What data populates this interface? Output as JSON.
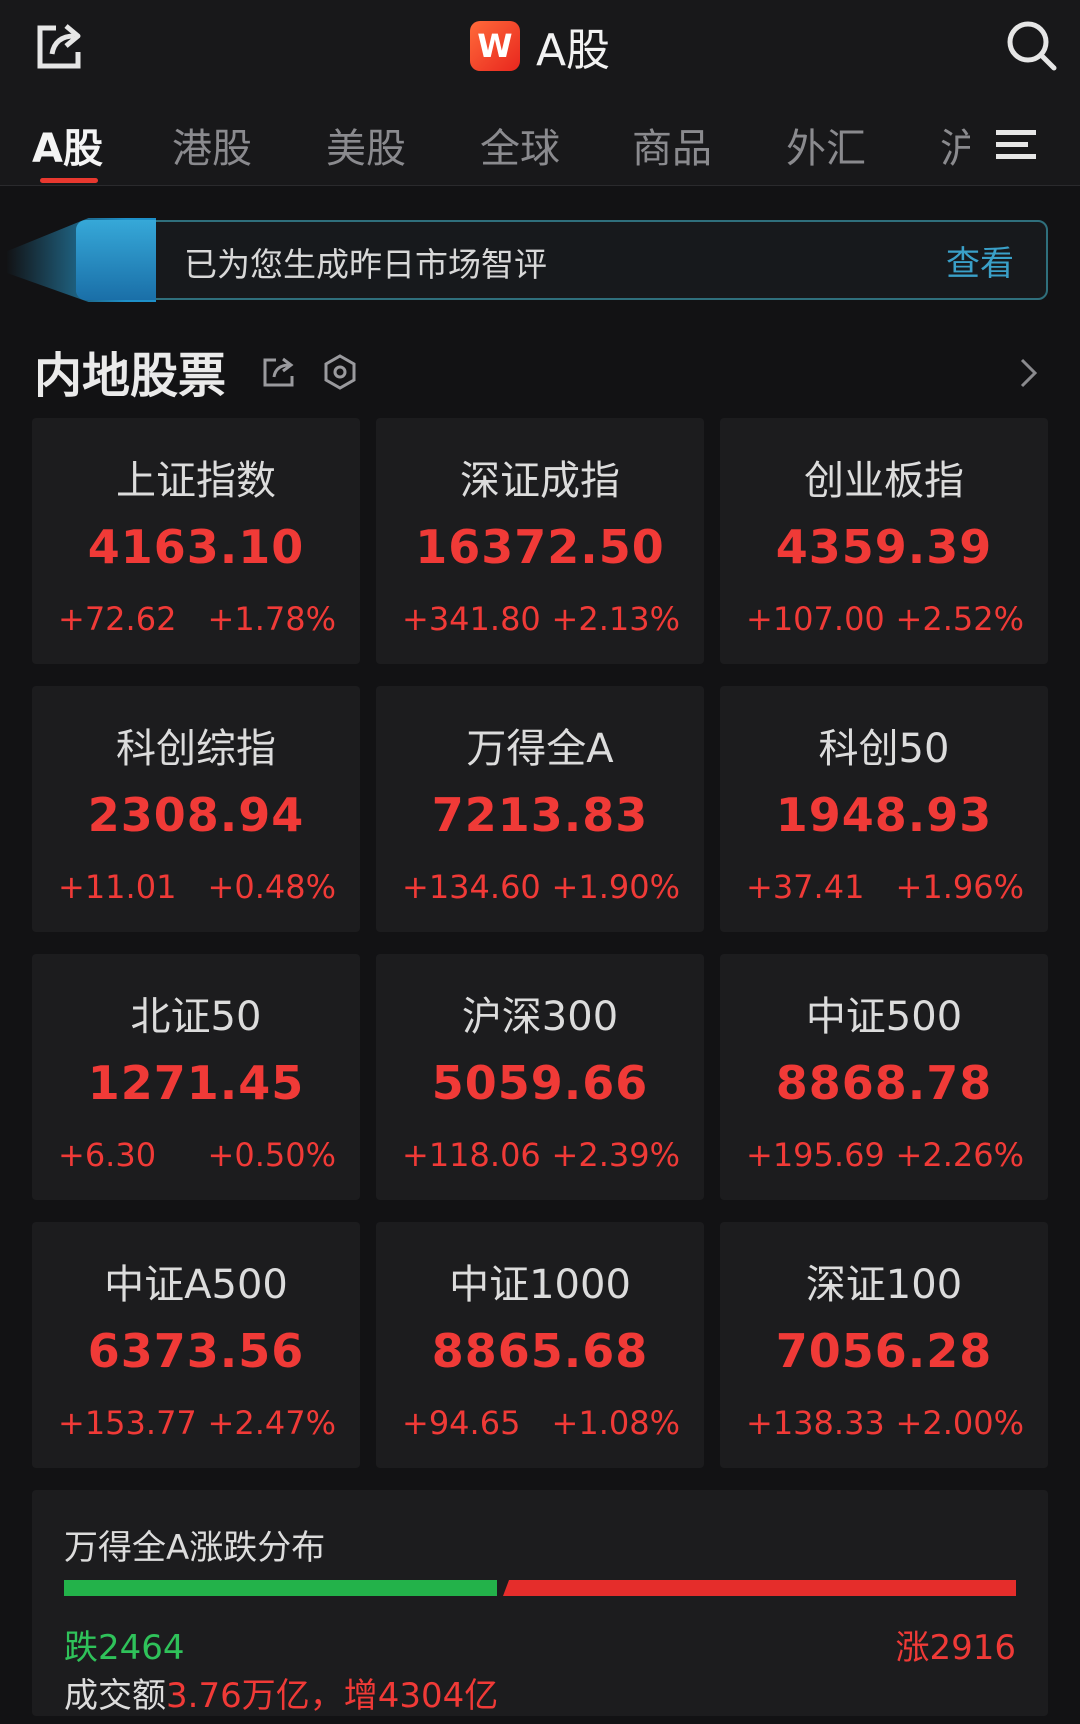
{
  "header": {
    "logo_letter": "W",
    "title": "A股"
  },
  "tabs": [
    {
      "label": "A股",
      "active": true
    },
    {
      "label": "港股",
      "active": false
    },
    {
      "label": "美股",
      "active": false
    },
    {
      "label": "全球",
      "active": false
    },
    {
      "label": "商品",
      "active": false
    },
    {
      "label": "外汇",
      "active": false
    },
    {
      "label": "沪",
      "active": false
    }
  ],
  "banner": {
    "text": "已为您生成昨日市场智评",
    "link": "查看"
  },
  "section": {
    "title": "内地股票"
  },
  "indices": [
    {
      "name": "上证指数",
      "value": "4163.10",
      "change": "+72.62",
      "pct": "+1.78%"
    },
    {
      "name": "深证成指",
      "value": "16372.50",
      "change": "+341.80",
      "pct": "+2.13%"
    },
    {
      "name": "创业板指",
      "value": "4359.39",
      "change": "+107.00",
      "pct": "+2.52%"
    },
    {
      "name": "科创综指",
      "value": "2308.94",
      "change": "+11.01",
      "pct": "+0.48%"
    },
    {
      "name": "万得全A",
      "value": "7213.83",
      "change": "+134.60",
      "pct": "+1.90%"
    },
    {
      "name": "科创50",
      "value": "1948.93",
      "change": "+37.41",
      "pct": "+1.96%"
    },
    {
      "name": "北证50",
      "value": "1271.45",
      "change": "+6.30",
      "pct": "+0.50%"
    },
    {
      "name": "沪深300",
      "value": "5059.66",
      "change": "+118.06",
      "pct": "+2.39%"
    },
    {
      "name": "中证500",
      "value": "8868.78",
      "change": "+195.69",
      "pct": "+2.26%"
    },
    {
      "name": "中证A500",
      "value": "6373.56",
      "change": "+153.77",
      "pct": "+2.47%"
    },
    {
      "name": "中证1000",
      "value": "8865.68",
      "change": "+94.65",
      "pct": "+1.08%"
    },
    {
      "name": "深证100",
      "value": "7056.28",
      "change": "+138.33",
      "pct": "+2.00%"
    }
  ],
  "distribution": {
    "title": "万得全A涨跌分布",
    "fall_label": "跌2464",
    "rise_label": "涨2916",
    "fall_count": 2464,
    "rise_count": 2916,
    "volume_prefix": "成交额",
    "volume_value": "3.76万亿，增4304亿"
  },
  "colors": {
    "up": "#f03a37",
    "down": "#2fc25a",
    "accent": "#3aa0c8"
  }
}
